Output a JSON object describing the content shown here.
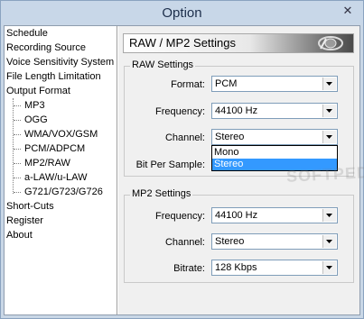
{
  "window": {
    "title": "Option",
    "close_glyph": "✕"
  },
  "tree": {
    "items": [
      {
        "label": "Schedule"
      },
      {
        "label": "Recording Source"
      },
      {
        "label": "Voice Sensitivity System"
      },
      {
        "label": "File Length Limitation"
      },
      {
        "label": "Output Format"
      },
      {
        "label": "MP3"
      },
      {
        "label": "OGG"
      },
      {
        "label": "WMA/VOX/GSM"
      },
      {
        "label": "PCM/ADPCM"
      },
      {
        "label": "MP2/RAW"
      },
      {
        "label": "a-LAW/u-LAW"
      },
      {
        "label": "G721/G723/G726"
      },
      {
        "label": "Short-Cuts"
      },
      {
        "label": "Register"
      },
      {
        "label": "About"
      }
    ]
  },
  "panel": {
    "title": "RAW / MP2 Settings",
    "raw_group": {
      "title": "RAW Settings",
      "format_label": "Format:",
      "format_value": "PCM",
      "frequency_label": "Frequency:",
      "frequency_value": "44100 Hz",
      "channel_label": "Channel:",
      "channel_value": "Stereo",
      "channel_options": [
        "Mono",
        "Stereo"
      ],
      "channel_selected": "Stereo",
      "bps_label": "Bit Per Sample:"
    },
    "mp2_group": {
      "title": "MP2 Settings",
      "frequency_label": "Frequency:",
      "frequency_value": "44100 Hz",
      "channel_label": "Channel:",
      "channel_value": "Stereo",
      "bitrate_label": "Bitrate:",
      "bitrate_value": "128 Kbps"
    }
  },
  "watermark": "SOFTPEDIA",
  "colors": {
    "selection": "#3399ff",
    "window_bg": "#c9d7e6",
    "panel_bg": "#f0f0f0"
  }
}
